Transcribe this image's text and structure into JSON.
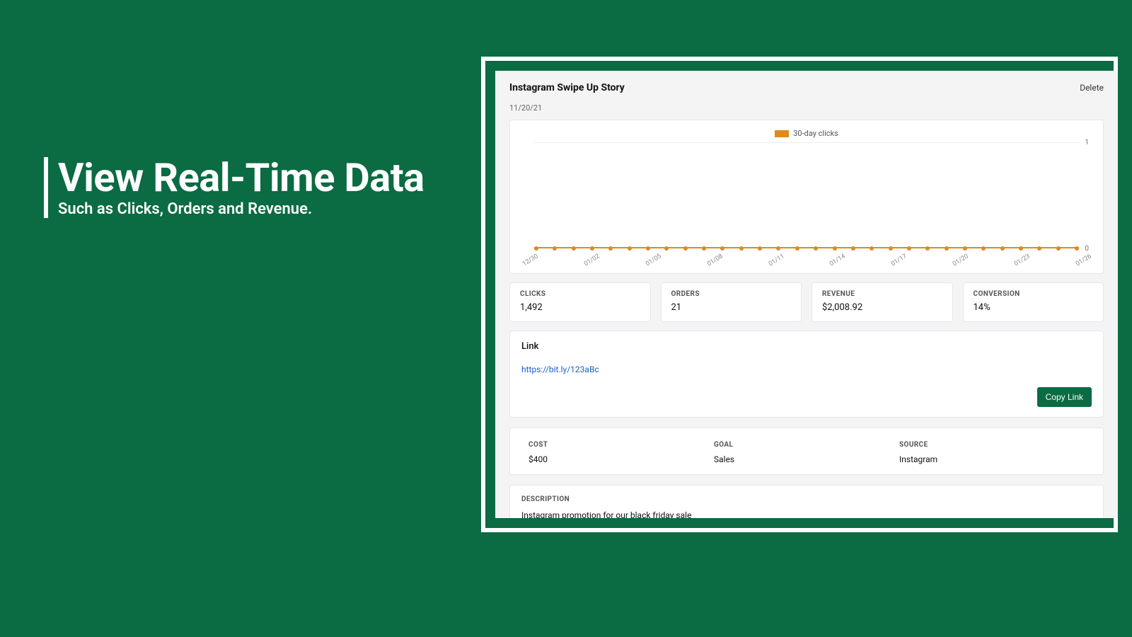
{
  "hero": {
    "title": "View Real-Time Data",
    "subtitle": "Such as Clicks, Orders and Revenue."
  },
  "header": {
    "title": "Instagram Swipe Up Story",
    "delete_label": "Delete",
    "date": "11/20/21"
  },
  "chart_data": {
    "type": "line",
    "title": "",
    "legend": "30-day clicks",
    "ylim": [
      0,
      1
    ],
    "yticks": [
      "1",
      "0"
    ],
    "categories": [
      "12/30",
      "01/02",
      "01/05",
      "01/08",
      "01/11",
      "01/14",
      "01/17",
      "01/20",
      "01/23",
      "01/26"
    ],
    "series": [
      {
        "name": "30-day clicks",
        "values": [
          0,
          0,
          0,
          0,
          0,
          0,
          0,
          0,
          0,
          0
        ]
      }
    ]
  },
  "stats": {
    "clicks": {
      "label": "CLICKS",
      "value": "1,492"
    },
    "orders": {
      "label": "ORDERS",
      "value": "21"
    },
    "revenue": {
      "label": "REVENUE",
      "value": "$2,008.92"
    },
    "conversion": {
      "label": "CONVERSION",
      "value": "14%"
    }
  },
  "link": {
    "heading": "Link",
    "url": "https://bit.ly/123aBc",
    "copy_label": "Copy Link"
  },
  "meta": {
    "cost": {
      "label": "COST",
      "value": "$400"
    },
    "goal": {
      "label": "GOAL",
      "value": "Sales"
    },
    "source": {
      "label": "SOURCE",
      "value": "Instagram"
    }
  },
  "description": {
    "label": "DESCRIPTION",
    "value": "Instagram promotion for our black friday sale"
  }
}
